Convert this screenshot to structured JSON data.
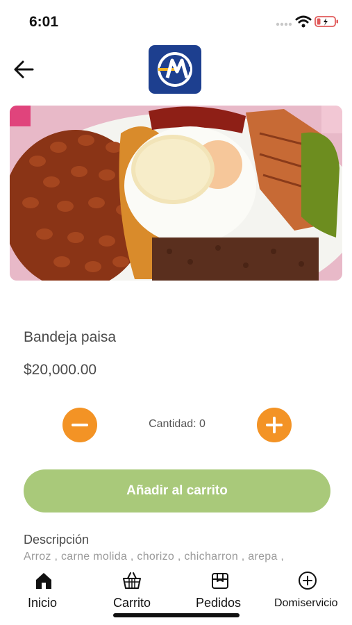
{
  "status_bar": {
    "time": "6:01"
  },
  "header": {
    "back_icon": "arrow-left-icon",
    "logo_icon": "brand-logo"
  },
  "product": {
    "name": "Bandeja paisa",
    "price": "$20,000.00",
    "quantity_label": "Cantidad: 0",
    "quantity": 0
  },
  "actions": {
    "add_to_cart_label": "Añadir al carrito"
  },
  "description": {
    "title": "Descripción",
    "text": "Arroz , carne molida , chorizo , chicharron , arepa ,"
  },
  "tabs": [
    {
      "label": "Inicio",
      "icon": "home-icon"
    },
    {
      "label": "Carrito",
      "icon": "basket-icon"
    },
    {
      "label": "Pedidos",
      "icon": "box-icon"
    },
    {
      "label": "Domiservicio",
      "icon": "plus-circle-icon"
    }
  ],
  "colors": {
    "accent": "#f39325",
    "button": "#a9c97a",
    "logo_bg": "#1d3f8f",
    "logo_stripe": "#f0b323"
  }
}
